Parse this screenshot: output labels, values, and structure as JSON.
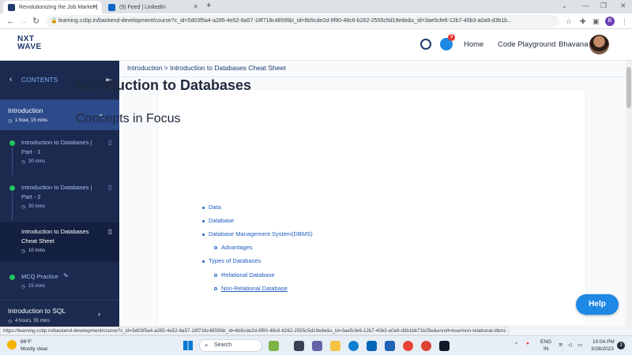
{
  "browser": {
    "tabs": [
      {
        "title": "Revolutionizing the Job Market |",
        "active": true,
        "favicon_color": "#1e3a6e"
      },
      {
        "title": "(9) Feed | LinkedIn",
        "active": false,
        "favicon_color": "#0a66c2"
      }
    ],
    "new_tab": "+",
    "url": "learning.ccbp.in/backend-development/course?c_id=5d03f5a4-a285-4e52-8a57-18f718c4859f&t_id=6b5cde2d-9f90-48c6-b262-2555c5d19e8e&s_id=3ae5cfe6-12b7-40b3-a0a9-d3b1b...",
    "profile_initial": "B"
  },
  "header": {
    "logo_line1": "NXT",
    "logo_line2": "WAVE",
    "notification_count": "9",
    "nav": [
      "Home",
      "Code Playground"
    ],
    "user_name": "Bhavana"
  },
  "sidebar": {
    "contents_label": "CONTENTS",
    "module": {
      "title": "Introduction",
      "duration": "1 hour, 15 mins"
    },
    "lessons": [
      {
        "title_1": "Introduction to Databases |",
        "title_2": "Part - 1",
        "duration": "30 mins"
      },
      {
        "title_1": "Introduction to Databases |",
        "title_2": "Part - 2",
        "duration": "30 mins"
      },
      {
        "title_1": "Introduction to Databases",
        "title_2": "Cheat Sheet",
        "duration": "10 mins"
      },
      {
        "title_1": "MCQ Practice",
        "title_2": "",
        "duration": "15 mins"
      }
    ],
    "next_module": {
      "title": "Introduction to SQL",
      "duration": "4 hours, 55 mins"
    }
  },
  "main": {
    "breadcrumb": "Introduction > Introduction to Databases Cheat Sheet",
    "title": "Introduction to Databases",
    "section_title": "Concepts in Focus",
    "topics": [
      {
        "label": "Data",
        "level": 1
      },
      {
        "label": "Database",
        "level": 1
      },
      {
        "label": "Database Management System(DBMS)",
        "level": 1
      },
      {
        "label": "Advantages",
        "level": 2
      },
      {
        "label": "Types of Databases",
        "level": 1
      },
      {
        "label": "Relational Database",
        "level": 2
      },
      {
        "label": "Non-Relational Database",
        "level": 2
      }
    ],
    "help_label": "Help"
  },
  "status_url": "https://learning.ccbp.in/backend-development/course?c_id=5d03f5a4-a285-4e52-8a57-18f718c4859f&t_id=6b5cde2d-9f90-48c6-b262-2555c5d19e8e&s_id=3ae5cfe6-12b7-40b3-a0a9-d3b1bb71b25e&enroll=true#non-relational-dbms",
  "taskbar": {
    "weather_temp": "86°F",
    "weather_desc": "Mostly clear",
    "search_label": "Search",
    "lang_1": "ENG",
    "lang_2": "IN",
    "time": "10:04 PM",
    "date": "3/28/2023",
    "notif_count": "3"
  },
  "colors": {
    "sidebar": "#1b2a4e",
    "module_active": "#2d4a8a",
    "link": "#1e5bbf",
    "help": "#1e88e5"
  }
}
